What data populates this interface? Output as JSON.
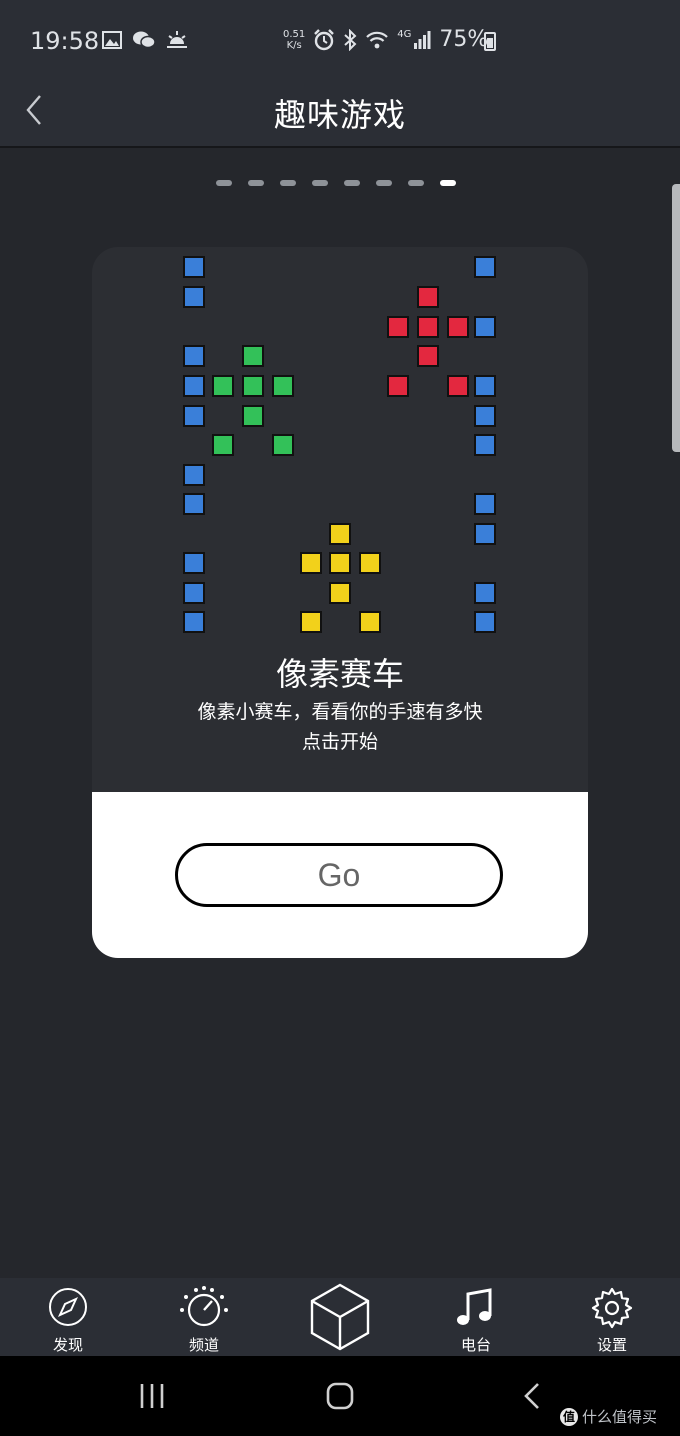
{
  "status_bar": {
    "time": "19:58",
    "net_speed_value": "0.51",
    "net_speed_unit": "K/s",
    "network": "4G",
    "battery": "75%"
  },
  "header": {
    "title": "趣味游戏"
  },
  "pager": {
    "count": 8,
    "active_index": 7
  },
  "game": {
    "name": "像素赛车",
    "description": "像素小赛车，看看你的手速有多快",
    "hint": "点击开始",
    "button_label": "Go"
  },
  "tabbar": {
    "items": [
      {
        "label": "发现",
        "icon": "compass-icon"
      },
      {
        "label": "频道",
        "icon": "dial-icon"
      },
      {
        "label": "",
        "icon": "cube-icon"
      },
      {
        "label": "电台",
        "icon": "music-note-icon"
      },
      {
        "label": "设置",
        "icon": "gear-icon"
      }
    ]
  },
  "watermark": {
    "text": "什么值得买",
    "logo_char": "值"
  },
  "colors": {
    "background": "#25272c",
    "bar": "#2b2e35",
    "block_blue": "#3a7fd9",
    "block_green": "#33c159",
    "block_red": "#e3283f",
    "block_yellow": "#f2d11b"
  }
}
